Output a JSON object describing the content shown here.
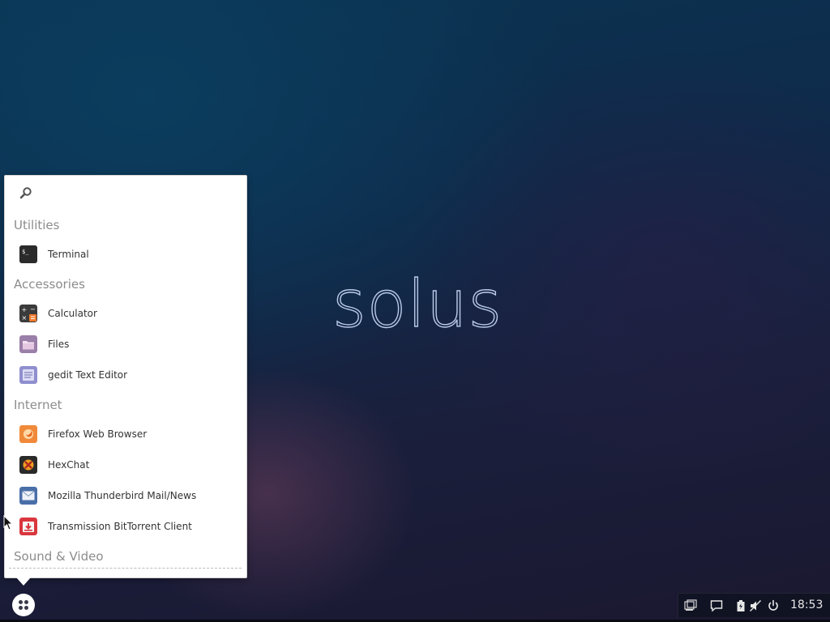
{
  "desktop": {
    "logo_text": "solus"
  },
  "menu": {
    "search": {
      "placeholder": "",
      "value": ""
    },
    "categories": [
      {
        "name": "Utilities",
        "items": [
          {
            "label": "Terminal",
            "icon": "terminal-icon"
          }
        ]
      },
      {
        "name": "Accessories",
        "items": [
          {
            "label": "Calculator",
            "icon": "calculator-icon"
          },
          {
            "label": "Files",
            "icon": "folder-icon"
          },
          {
            "label": "gedit Text Editor",
            "icon": "text-editor-icon"
          }
        ]
      },
      {
        "name": "Internet",
        "items": [
          {
            "label": "Firefox Web Browser",
            "icon": "firefox-icon"
          },
          {
            "label": "HexChat",
            "icon": "hexchat-icon"
          },
          {
            "label": "Mozilla Thunderbird Mail/News",
            "icon": "mail-icon"
          },
          {
            "label": "Transmission BitTorrent Client",
            "icon": "torrent-icon"
          }
        ]
      },
      {
        "name": "Sound & Video",
        "items": []
      }
    ]
  },
  "panel": {
    "clock": "18:53",
    "tray_icons": [
      "workspace-icon",
      "notification-icon",
      "battery-icon",
      "volume-muted-icon",
      "power-icon"
    ]
  },
  "colors": {
    "accent_terminal": "#2d2d2d",
    "accent_firefox": "#f08a3a",
    "accent_transmission": "#d9363e"
  }
}
